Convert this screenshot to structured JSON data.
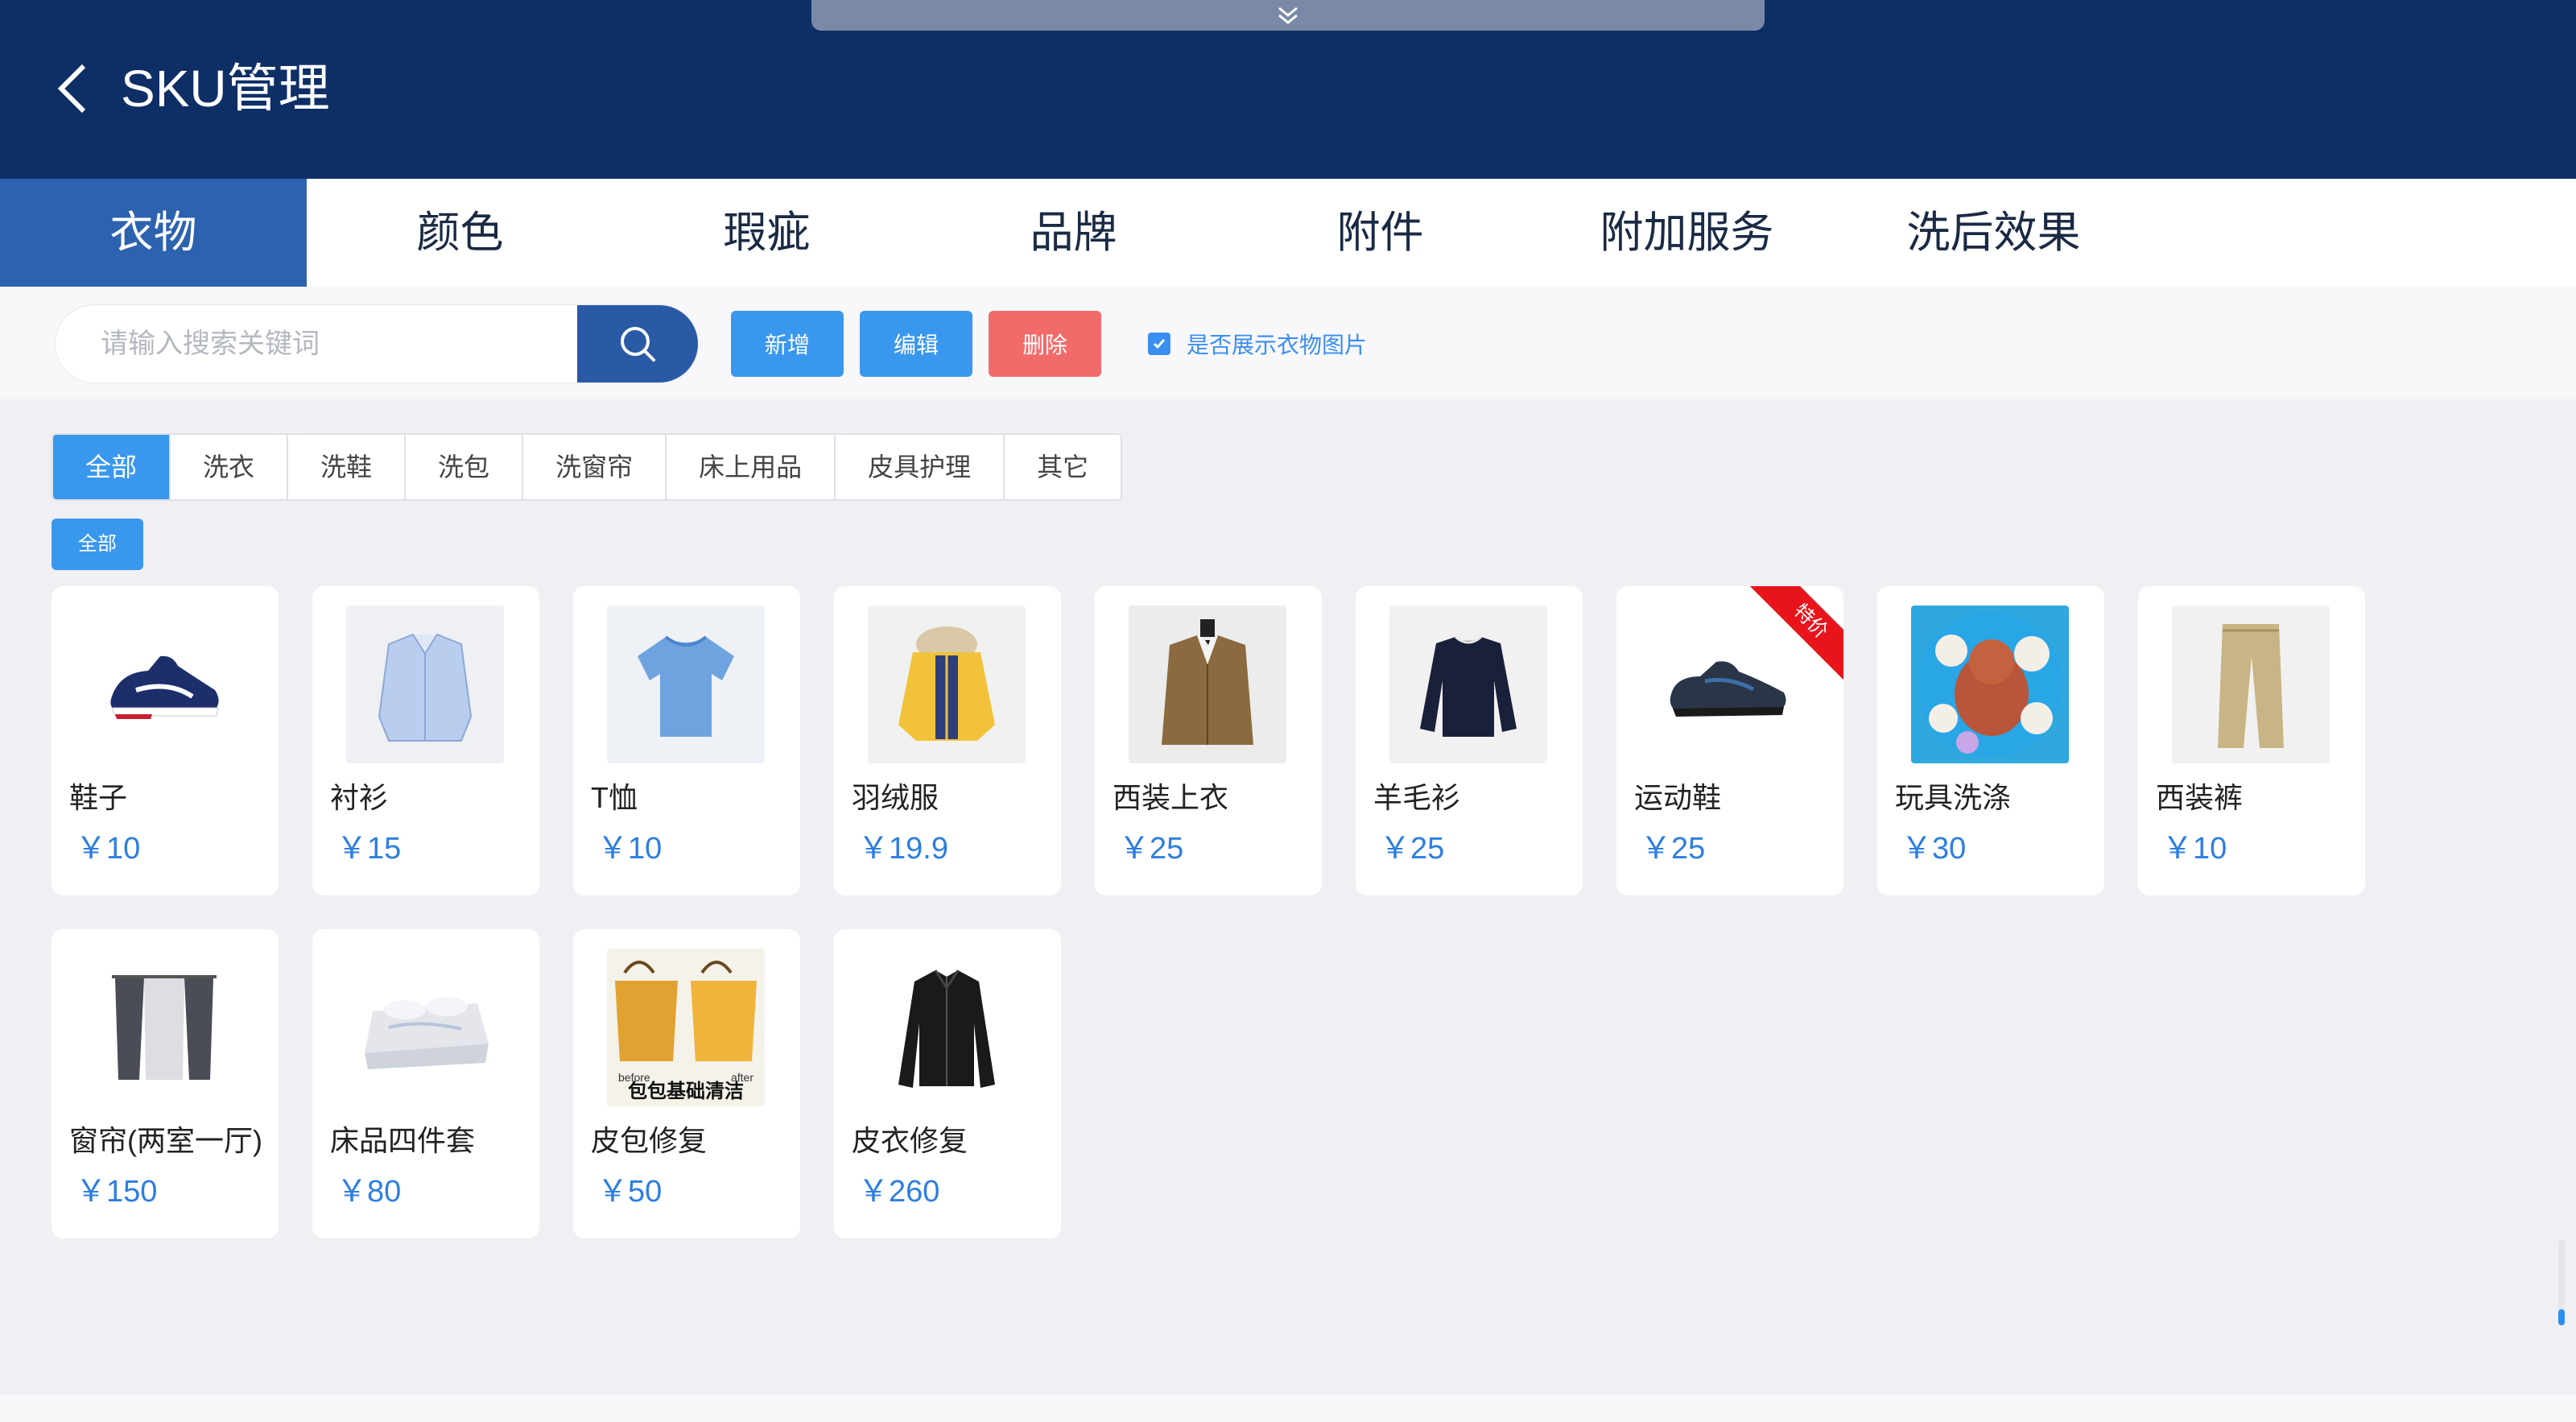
{
  "header": {
    "title": "SKU管理"
  },
  "tabs": [
    {
      "label": "衣物",
      "active": true
    },
    {
      "label": "颜色",
      "active": false
    },
    {
      "label": "瑕疵",
      "active": false
    },
    {
      "label": "品牌",
      "active": false
    },
    {
      "label": "附件",
      "active": false
    },
    {
      "label": "附加服务",
      "active": false
    },
    {
      "label": "洗后效果",
      "active": false
    }
  ],
  "toolbar": {
    "search_placeholder": "请输入搜索关键词",
    "add_label": "新增",
    "edit_label": "编辑",
    "delete_label": "删除",
    "show_images_label": "是否展示衣物图片",
    "show_images_checked": true
  },
  "categories": [
    "全部",
    "洗衣",
    "洗鞋",
    "洗包",
    "洗窗帘",
    "床上用品",
    "皮具护理",
    "其它"
  ],
  "selected_category": "全部",
  "subcategory": "全部",
  "products": [
    {
      "name": "鞋子",
      "price": "￥10",
      "icon": "sneaker-icon"
    },
    {
      "name": "衬衫",
      "price": "￥15",
      "icon": "shirt-icon"
    },
    {
      "name": "T恤",
      "price": "￥10",
      "icon": "tshirt-icon"
    },
    {
      "name": "羽绒服",
      "price": "￥19.9",
      "icon": "down-jacket-icon"
    },
    {
      "name": "西装上衣",
      "price": "￥25",
      "icon": "suit-jacket-icon"
    },
    {
      "name": "羊毛衫",
      "price": "￥25",
      "icon": "sweater-icon"
    },
    {
      "name": "运动鞋",
      "price": "￥25",
      "icon": "sport-shoe-icon",
      "badge": "特价"
    },
    {
      "name": "玩具洗涤",
      "price": "￥30",
      "icon": "plush-toys-icon"
    },
    {
      "name": "西装裤",
      "price": "￥10",
      "icon": "trousers-icon"
    },
    {
      "name": "窗帘(两室一厅)",
      "price": "￥150",
      "icon": "curtain-icon"
    },
    {
      "name": "床品四件套",
      "price": "￥80",
      "icon": "bedding-icon"
    },
    {
      "name": "皮包修复",
      "price": "￥50",
      "icon": "handbag-icon",
      "thumb_caption": "包包基础清洁",
      "thumb_before": "before",
      "thumb_after": "after"
    },
    {
      "name": "皮衣修复",
      "price": "￥260",
      "icon": "leather-jacket-icon"
    }
  ],
  "colors": {
    "header_bg": "#0e2f66",
    "tab_active_bg": "#2d62ae",
    "primary_button": "#3a97ee",
    "danger_button": "#f26b6b",
    "price_text": "#2d7ee0",
    "badge_red": "#e8141b"
  }
}
